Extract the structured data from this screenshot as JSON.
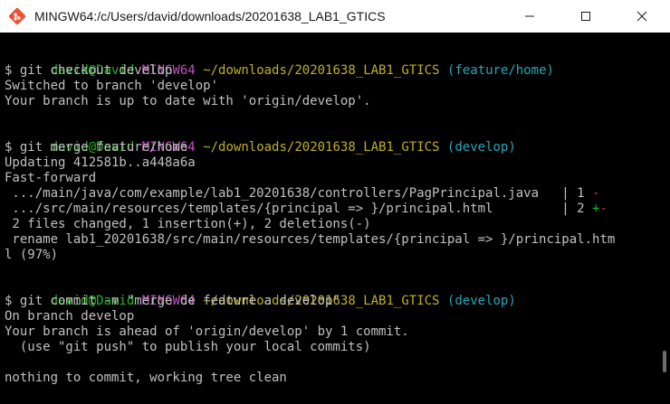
{
  "window": {
    "title": "MINGW64:/c/Users/david/downloads/20201638_LAB1_GTICS",
    "controls": {
      "minimize_icon": "minimize-icon",
      "maximize_icon": "maximize-icon",
      "close_icon": "close-icon"
    },
    "icon": "git-bash-icon"
  },
  "colors": {
    "user": "#1fb31f",
    "msystem": "#c052c0",
    "path": "#c0b020",
    "branch": "#22a8b8",
    "text": "#c0c0c0",
    "deletion": "#d83b3b",
    "insertion": "#1fb31f"
  },
  "terminal": {
    "prompt1": {
      "user": "david@David",
      "msystem": "MINGW64",
      "path": "~/downloads/20201638_LAB1_GTICS",
      "branch": "(feature/home)"
    },
    "cmd1": "$ git checkout develop",
    "out1": [
      "Switched to branch 'develop'",
      "Your branch is up to date with 'origin/develop'."
    ],
    "prompt2": {
      "user": "david@David",
      "msystem": "MINGW64",
      "path": "~/downloads/20201638_LAB1_GTICS",
      "branch": "(develop)"
    },
    "cmd2": "$ git merge feature/home",
    "out2": [
      "Updating 412581b..a448a6a",
      "Fast-forward"
    ],
    "diffstat": [
      {
        "text": " .../main/java/com/example/lab1_20201638/controllers/PagPrincipal.java   | 1 ",
        "plus": "",
        "minus": "-"
      },
      {
        "text": " .../src/main/resources/templates/{principal => }/principal.html         | 2 ",
        "plus": "+",
        "minus": "-"
      }
    ],
    "summary": " 2 files changed, 1 insertion(+), 2 deletions(-)",
    "rename": [
      " rename lab1_20201638/src/main/resources/templates/{principal => }/principal.htm",
      "l (97%)"
    ],
    "prompt3": {
      "user": "david@David",
      "msystem": "MINGW64",
      "path": "~/downloads/20201638_LAB1_GTICS",
      "branch": "(develop)"
    },
    "cmd3": "$ git commit -m \"merge de feature a develop\"",
    "out3": [
      "On branch develop",
      "Your branch is ahead of 'origin/develop' by 1 commit.",
      "  (use \"git push\" to publish your local commits)",
      "",
      "nothing to commit, working tree clean"
    ]
  }
}
